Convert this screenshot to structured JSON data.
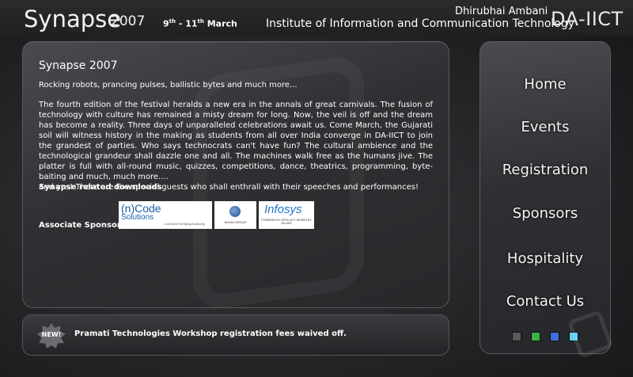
{
  "header": {
    "logo_text": "Synapse",
    "logo_year": "2007",
    "date_day_start": "9",
    "date_day_end": "11",
    "date_suffix": "th",
    "date_month": "March",
    "institute_name": "Dhirubhai Ambani",
    "institute_full": "Institute of Information and Communication Technology",
    "institute_abbr": "DA-IICT"
  },
  "main": {
    "title": "Synapse 2007",
    "tagline": "Rocking robots, prancing pulses, ballistic bytes and much more...",
    "paragraph_1": "The fourth edition of the festival heralds a new era in the annals of great carnivals. The fusion of technology with culture has remained a misty dream for long. Now, the veil is off and the dream has become a reality. Three days of unparalleled celebrations await us. Come March, the Gujarati soil will witness history in the making as students from all over India converge in DA-IICT to join the grandest of parties. Who says technocrats can't have fun? The cultural ambience and the technological grandeur shall dazzle one and all. The machines walk free as the humans jive. The platter is full with all-round music, quizzes, competitions, dance, theatrics, programming, byte-baiting and much, much more....",
    "paragraph_2": "and yes! There are the special guests who shall enthrall with their speeches and performances!",
    "downloads_link": "Synapse related downloads",
    "sponsors_label": "Associate Sponsors :"
  },
  "sponsors": {
    "ncode_line1": "(n)Code",
    "ncode_line2": "Solutions",
    "ncode_tagline": "Licensed Certifying Authority",
    "adani_label": "ADANI GROUP",
    "infosys_name": "Infosys",
    "infosys_tagline": "POWERED BY INTELLECT DRIVEN BY VALUES"
  },
  "news": {
    "badge": "NEW!",
    "text": "Pramati Technologies Workshop registration fees waived off."
  },
  "nav": {
    "items": [
      "Home",
      "Events",
      "Registration",
      "Sponsors",
      "Hospitality",
      "Contact Us"
    ]
  },
  "theme_swatches": [
    "#5a5a5a",
    "#3cb043",
    "#3e6fd6",
    "#5fd0f0"
  ]
}
